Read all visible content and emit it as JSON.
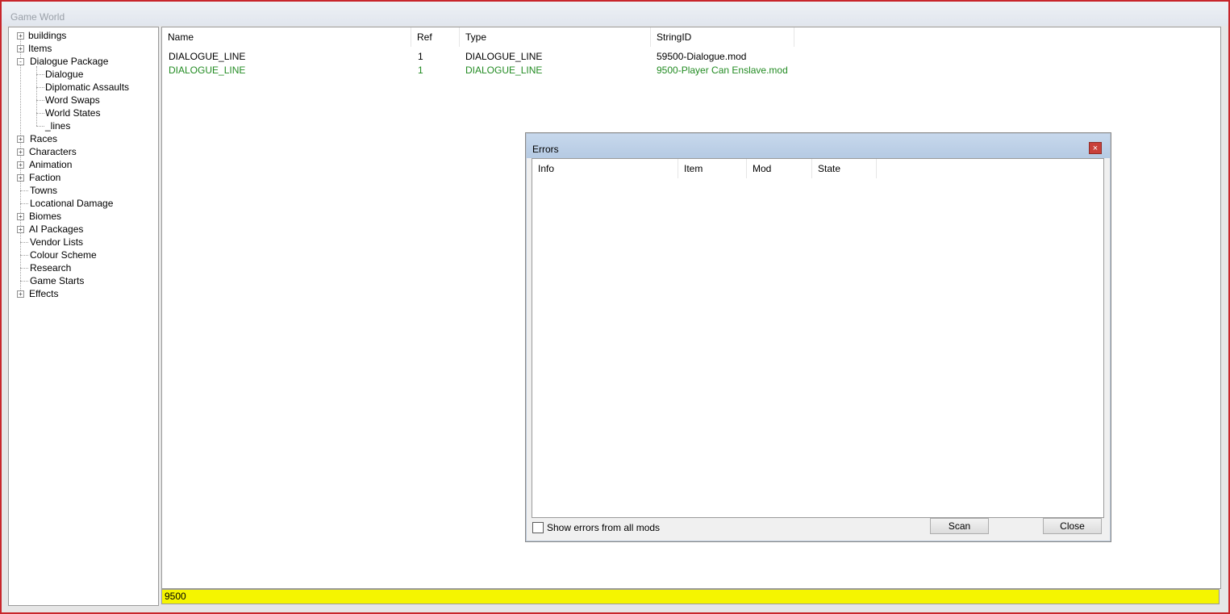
{
  "window": {
    "title": "Game World"
  },
  "tree": {
    "items": [
      {
        "label": "buildings",
        "expander": "+"
      },
      {
        "label": "Items",
        "expander": "+"
      },
      {
        "label": "Dialogue Package",
        "expander": "-"
      },
      {
        "label": "Dialogue",
        "expander": ""
      },
      {
        "label": "Diplomatic Assaults",
        "expander": ""
      },
      {
        "label": "Word Swaps",
        "expander": ""
      },
      {
        "label": "World States",
        "expander": ""
      },
      {
        "label": "_lines",
        "expander": ""
      },
      {
        "label": "Races",
        "expander": "+"
      },
      {
        "label": "Characters",
        "expander": "+"
      },
      {
        "label": "Animation",
        "expander": "+"
      },
      {
        "label": "Faction",
        "expander": "+"
      },
      {
        "label": "Towns",
        "expander": ""
      },
      {
        "label": "Locational Damage",
        "expander": ""
      },
      {
        "label": "Biomes",
        "expander": "+"
      },
      {
        "label": "AI Packages",
        "expander": "+"
      },
      {
        "label": "Vendor Lists",
        "expander": ""
      },
      {
        "label": "Colour Scheme",
        "expander": ""
      },
      {
        "label": "Research",
        "expander": ""
      },
      {
        "label": "Game Starts",
        "expander": ""
      },
      {
        "label": "Effects",
        "expander": "+"
      }
    ]
  },
  "list": {
    "columns": [
      "Name",
      "Ref",
      "Type",
      "StringID"
    ],
    "rows": [
      {
        "name": "DIALOGUE_LINE",
        "ref": "1",
        "type": "DIALOGUE_LINE",
        "string_id": "59500-Dialogue.mod",
        "color": "#000000"
      },
      {
        "name": "DIALOGUE_LINE",
        "ref": "1",
        "type": "DIALOGUE_LINE",
        "string_id": "9500-Player Can Enslave.mod",
        "color": "#228b22"
      }
    ]
  },
  "search": {
    "value": "9500",
    "background": "#f5f500"
  },
  "errors_dialog": {
    "title": "Errors",
    "close_glyph": "×",
    "columns": [
      "Info",
      "Item",
      "Mod",
      "State"
    ],
    "show_all_label": "Show errors from all mods",
    "scan_label": "Scan",
    "close_label": "Close"
  }
}
